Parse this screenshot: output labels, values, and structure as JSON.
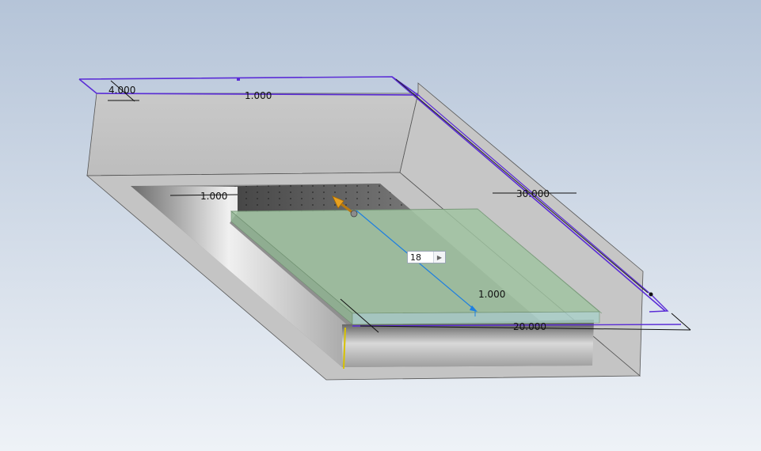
{
  "viewport": {
    "background_top": "#b7c6d9",
    "background_bottom": "#eef2f7"
  },
  "dimensions": {
    "wall_height": "4.000",
    "top_wall_thickness": "1.000",
    "inner_left_wall": "1.000",
    "length": "30.000",
    "plate_thickness": "1.000",
    "width": "20.000"
  },
  "edit_box": {
    "value": "18",
    "arrow_icon": "triangle-right-icon"
  },
  "colors": {
    "sketch_profile": "#5a2cd6",
    "preview_plate": "#9fc3a0",
    "drag_handle": "#d98c0a",
    "measure_line": "#1e7fe0",
    "axis_marker": "#d8c200"
  }
}
